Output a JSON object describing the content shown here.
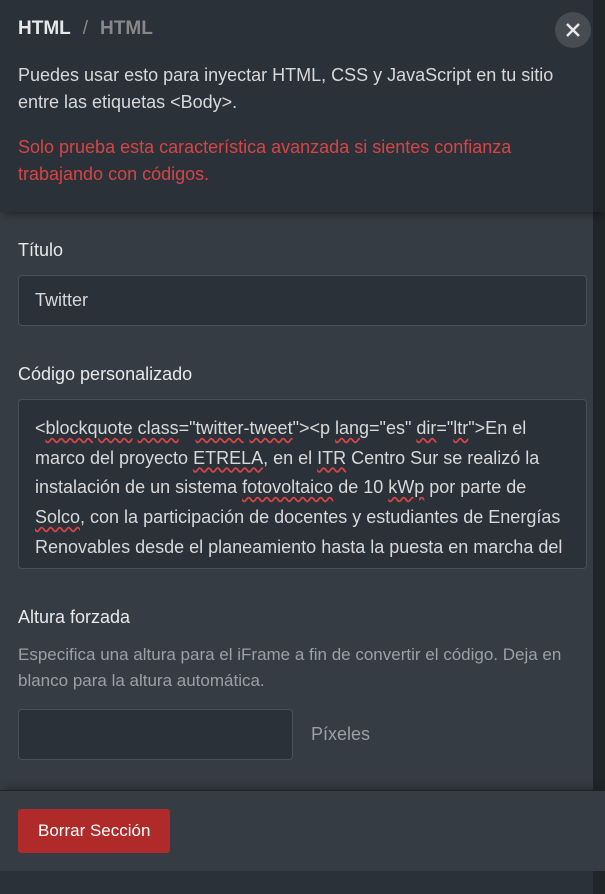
{
  "breadcrumb": {
    "root": "HTML",
    "sep": "/",
    "current": "HTML"
  },
  "header": {
    "intro": "Puedes usar esto para inyectar HTML, CSS y JavaScript en tu sitio entre las etiquetas <Body>.",
    "warning": "Solo prueba esta característica avanzada si sientes confianza trabajando con códigos."
  },
  "fields": {
    "title": {
      "label": "Título",
      "value": "Twitter"
    },
    "code": {
      "label": "Código personalizado",
      "value": "<blockquote class=\"twitter-tweet\"><p lang=\"es\" dir=\"ltr\">En el marco del proyecto ETRELA, en el ITR Centro Sur se realizó la instalación de un sistema fotovoltaico de 10 kWp por parte de Solco, con la participación de docentes y estudiantes de Energías Renovables desde el planeamiento hasta la puesta en marcha del"
    },
    "height": {
      "label": "Altura forzada",
      "help": "Especifica una altura para el iFrame a fin de convertir el código. Deja en blanco para la altura automática.",
      "value": "",
      "unit": "Píxeles"
    }
  },
  "footer": {
    "delete": "Borrar Sección"
  }
}
